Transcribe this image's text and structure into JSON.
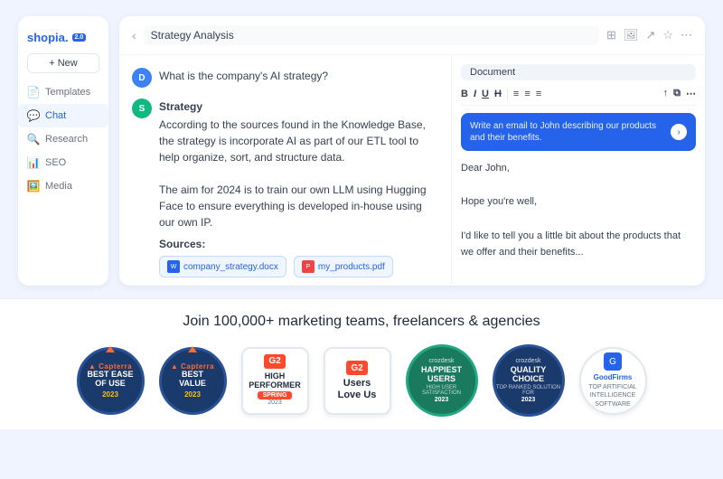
{
  "app": {
    "logo_text": "shopia.",
    "logo_badge": "2.0",
    "new_button": "+ New",
    "breadcrumb_value": "Strategy Analysis"
  },
  "sidebar": {
    "items": [
      {
        "label": "Templates",
        "icon": "📄"
      },
      {
        "label": "Chat",
        "icon": "💬",
        "active": true
      },
      {
        "label": "Research",
        "icon": "🔍"
      },
      {
        "label": "SEO",
        "icon": "📊"
      },
      {
        "label": "Media",
        "icon": "🖼️"
      }
    ]
  },
  "chat": {
    "user_question": "What is the company's AI strategy?",
    "response_title": "Strategy",
    "response_body": "According to the sources found in the Knowledge Base, the strategy is incorporate AI as part of our ETL tool to help organize, sort, and structure data.\n\nThe aim for 2024 is to train our own LLM using Hugging Face to ensure everything is developed in-house using our own IP.",
    "sources_label": "Sources:",
    "source_files": [
      {
        "name": "company_strategy.docx",
        "type": "docx"
      },
      {
        "name": "my_products.pdf",
        "type": "pdf"
      }
    ]
  },
  "document": {
    "tab_label": "Document",
    "toolbar": {
      "bold": "B",
      "italic": "I",
      "underline": "U",
      "strikethrough": "H",
      "align_left": "≡",
      "align_center": "≡",
      "align_right": "≡"
    },
    "ai_input_placeholder": "Write an email to John describing our products and their benefits.",
    "content_lines": [
      "Dear John,",
      "",
      "Hope you're well,",
      "",
      "I'd like to tell you a little bit about the products that we offer and their benefits..."
    ]
  },
  "marketing": {
    "title": "Join 100,000+ marketing teams, freelancers & agencies",
    "badges": [
      {
        "id": "capterra-ease",
        "type": "capterra",
        "top_label": "Capterra",
        "main_label": "BEST EASE OF USE",
        "year": "2023"
      },
      {
        "id": "capterra-value",
        "type": "capterra",
        "top_label": "Capterra",
        "main_label": "BEST VALUE",
        "year": "2023"
      },
      {
        "id": "g2-high-performer",
        "type": "g2-performer",
        "main_label": "High Performer",
        "season": "SPRING",
        "year": "2023"
      },
      {
        "id": "g2-users-love",
        "type": "g2-love",
        "line1": "Users",
        "line2": "Love Us"
      },
      {
        "id": "crozdesk-happiest",
        "type": "crozdesk-happy",
        "provider": "crozdesk",
        "main_label": "HAPPIEST USERS",
        "sub_label": "HIGH USER SATISFACTION",
        "year": "2023"
      },
      {
        "id": "crozdesk-quality",
        "type": "crozdesk-quality",
        "provider": "crozdesk",
        "main_label": "QUALITY CHOICE",
        "sub_label": "TOP RANKED SOLUTION FOR",
        "year": "2023"
      },
      {
        "id": "goodfirms",
        "type": "goodfirms",
        "main_label": "GoodFirms",
        "sub_label": "TOP ARTIFICIAL INTELLIGENCE SOFTWARE"
      }
    ]
  },
  "header_icons": {
    "grid": "⊞",
    "image": "🖼",
    "share": "↗",
    "star": "☆",
    "more": "⋯"
  }
}
